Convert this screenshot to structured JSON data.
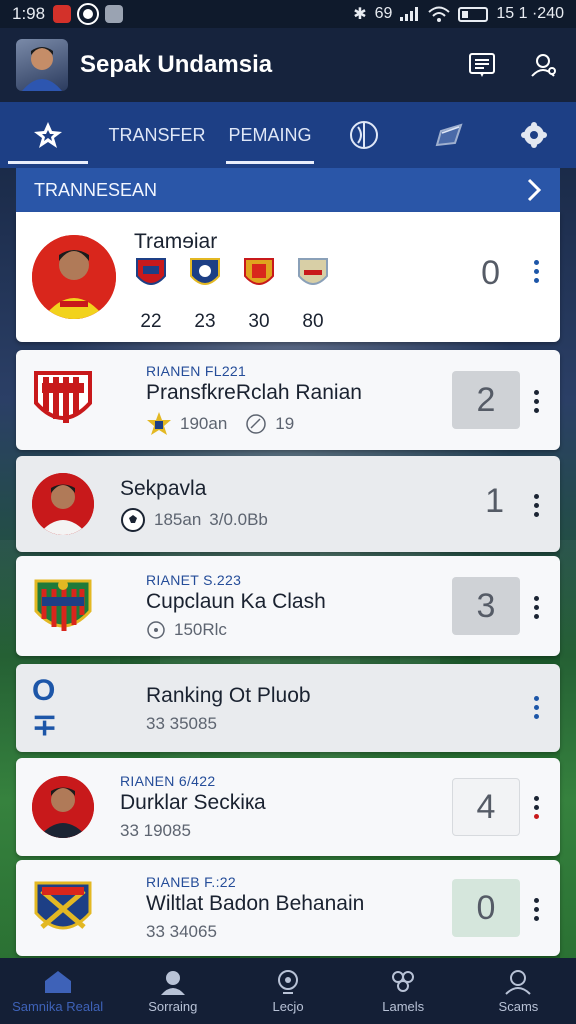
{
  "status_bar": {
    "time": "1:98",
    "battery_text": "15 1 ·240",
    "signal_text": "69"
  },
  "app": {
    "title": "Sepak Undamsia"
  },
  "tabs": [
    {
      "label": "",
      "icon": "star-icon",
      "active": true
    },
    {
      "label": "TRANSFER",
      "active": false
    },
    {
      "label": "PEMAING",
      "active": true
    },
    {
      "label": "",
      "icon": "ball-icon"
    },
    {
      "label": "",
      "icon": "boot-icon"
    },
    {
      "label": "",
      "icon": "settings-icon"
    }
  ],
  "section": {
    "title": "TRANNESEAN"
  },
  "featured": {
    "title": "Tramɘiar",
    "clubs": [
      {
        "value": "22",
        "color": "#c8191b"
      },
      {
        "value": "23",
        "color": "#1d3f85"
      },
      {
        "value": "30",
        "color": "#d9261c"
      },
      {
        "value": "80",
        "color": "#8aa0b8"
      }
    ],
    "score": "0"
  },
  "rows": [
    {
      "kicker": "RIANEN FL221",
      "title": "PransfkreRclah Ranian",
      "meta1": "190an",
      "meta2": "19",
      "score": "2",
      "score_style": "box",
      "thumb": "crest-red"
    },
    {
      "kicker": "",
      "title": "Sekpavla",
      "meta1": "185an",
      "meta2": "3/0.0Bb",
      "score": "1",
      "score_style": "plain",
      "thumb": "player"
    },
    {
      "kicker": "RIANET S.223",
      "title": "Cupclaun Ka Clash",
      "meta1": "150Rlc",
      "meta2": "",
      "score": "3",
      "score_style": "box",
      "thumb": "crest-green"
    },
    {
      "kicker": "",
      "title": "Ranking Ot Pluob",
      "meta1": "33 35085",
      "meta2": "",
      "score": "",
      "score_style": "none",
      "thumb": "text",
      "thumb_text": "O ∓"
    },
    {
      "kicker": "RIANEN 6/422",
      "title": "Durklar Seckiкa",
      "meta1": "33 19085",
      "meta2": "",
      "score": "4",
      "score_style": "box",
      "thumb": "player"
    },
    {
      "kicker": "RIANEB F.:22",
      "title": "Wiltlat Badon Behanain",
      "meta1": "33 34065",
      "meta2": "",
      "score": "0",
      "score_style": "box-green",
      "thumb": "crest-blue"
    }
  ],
  "bottom_nav": [
    {
      "label": "Samnika Realal",
      "icon": "home-icon",
      "active": true
    },
    {
      "label": "Sorraing",
      "icon": "person-icon"
    },
    {
      "label": "Lecjo",
      "icon": "search-icon"
    },
    {
      "label": "Lamels",
      "icon": "group-icon"
    },
    {
      "label": "Scams",
      "icon": "profile-icon"
    }
  ],
  "colors": {
    "primary": "#1d3f85",
    "accent": "#2a56a8",
    "dark": "#16233d"
  }
}
